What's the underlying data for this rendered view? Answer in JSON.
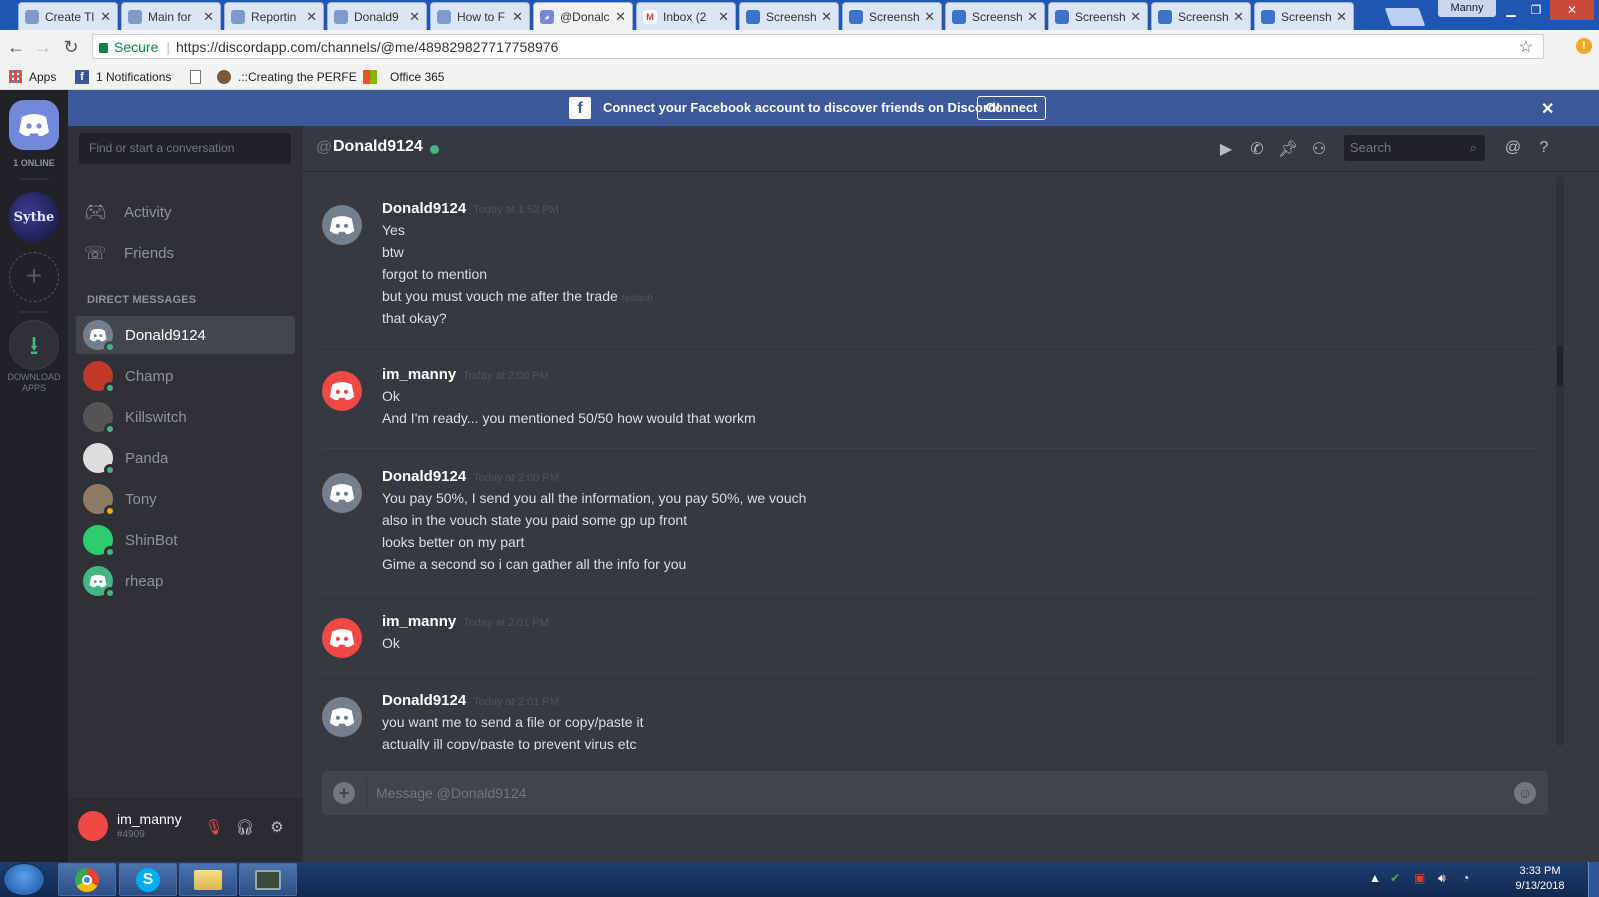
{
  "browser": {
    "tabs": [
      {
        "title": "Create Tl",
        "icon": "shield-icon",
        "active": false
      },
      {
        "title": "Main for",
        "icon": "shield-icon",
        "active": false
      },
      {
        "title": "Reportin",
        "icon": "shield-icon",
        "active": false
      },
      {
        "title": "Donald9",
        "icon": "shield-icon",
        "active": false
      },
      {
        "title": "How to F",
        "icon": "shield-icon",
        "active": false
      },
      {
        "title": "@Donalc",
        "icon": "discord-icon",
        "active": true
      },
      {
        "title": "Inbox (2",
        "icon": "gmail-icon",
        "active": false
      },
      {
        "title": "Screensh",
        "icon": "screenshot-icon",
        "active": false
      },
      {
        "title": "Screensh",
        "icon": "screenshot-icon",
        "active": false
      },
      {
        "title": "Screensh",
        "icon": "screenshot-icon",
        "active": false
      },
      {
        "title": "Screensh",
        "icon": "screenshot-icon",
        "active": false
      },
      {
        "title": "Screensh",
        "icon": "screenshot-icon",
        "active": false
      },
      {
        "title": "Screensh",
        "icon": "screenshot-icon",
        "active": false
      }
    ],
    "profile_name": "Manny",
    "secure_label": "Secure",
    "url": "https://discordapp.com/channels/@me/489829827717758976",
    "bookmarks": {
      "apps": "Apps",
      "notifications": "1 Notifications",
      "creating": ".::Creating the PERFE",
      "office": "Office 365"
    }
  },
  "discord": {
    "online_count": "1 ONLINE",
    "server_name": "Sythe",
    "download_label": "DOWNLOAD APPS",
    "dm_search_placeholder": "Find or start a conversation",
    "nav": {
      "activity": "Activity",
      "friends": "Friends"
    },
    "dm_header": "DIRECT MESSAGES",
    "dms": [
      {
        "name": "Donald9124",
        "status": "online",
        "selected": true,
        "avatar_color": "#747f8d"
      },
      {
        "name": "Champ",
        "status": "online",
        "selected": false,
        "avatar_color": "#c0392b"
      },
      {
        "name": "Killswitch",
        "status": "online",
        "selected": false,
        "avatar_color": "#555555"
      },
      {
        "name": "Panda",
        "status": "online",
        "selected": false,
        "avatar_color": "#dddddd"
      },
      {
        "name": "Tony",
        "status": "idle",
        "selected": false,
        "avatar_color": "#8d7b63"
      },
      {
        "name": "ShinBot",
        "status": "online",
        "selected": false,
        "avatar_color": "#2ecc71"
      },
      {
        "name": "rheap",
        "status": "online",
        "selected": false,
        "avatar_color": "#43b581"
      }
    ],
    "user": {
      "name": "im_manny",
      "tag": "#4909"
    },
    "banner": {
      "text": "Connect your Facebook account to discover friends on Discord!",
      "button": "Connect"
    },
    "channel": {
      "at": "@",
      "name": "Donald9124"
    },
    "header_search": "Search",
    "messages": [
      {
        "author": "Donald9124",
        "timestamp": "Today at 1:52 PM",
        "avatar_color": "#747f8d",
        "lines": [
          "Yes",
          "btw",
          "forgot to mention",
          "but you must vouch me after the trade",
          "that okay?"
        ],
        "edited_label": "(edited)"
      },
      {
        "author": "im_manny",
        "timestamp": "Today at 2:00 PM",
        "avatar_color": "#f04747",
        "lines": [
          "Ok",
          "And I'm ready... you mentioned 50/50 how would that workm"
        ]
      },
      {
        "author": "Donald9124",
        "timestamp": "Today at 2:00 PM",
        "avatar_color": "#747f8d",
        "lines": [
          "You pay 50%, I send you all the information, you pay 50%, we vouch",
          "also in the vouch state you paid some gp up front",
          "looks better on my part",
          "Gime a second so i can gather all the info for you"
        ]
      },
      {
        "author": "im_manny",
        "timestamp": "Today at 2:01 PM",
        "avatar_color": "#f04747",
        "lines": [
          "Ok"
        ]
      },
      {
        "author": "Donald9124",
        "timestamp": "Today at 2:01 PM",
        "avatar_color": "#747f8d",
        "lines": [
          "you want me to send a file or copy/paste it",
          "actually ill copy/paste to prevent virus etc"
        ]
      }
    ],
    "composer_placeholder": "Message @Donald9124"
  },
  "taskbar": {
    "time": "3:33 PM",
    "date": "9/13/2018"
  },
  "colors": {
    "blurple": "#7289da",
    "online": "#43b581",
    "idle": "#faa61a",
    "facebook": "#3b5998"
  }
}
